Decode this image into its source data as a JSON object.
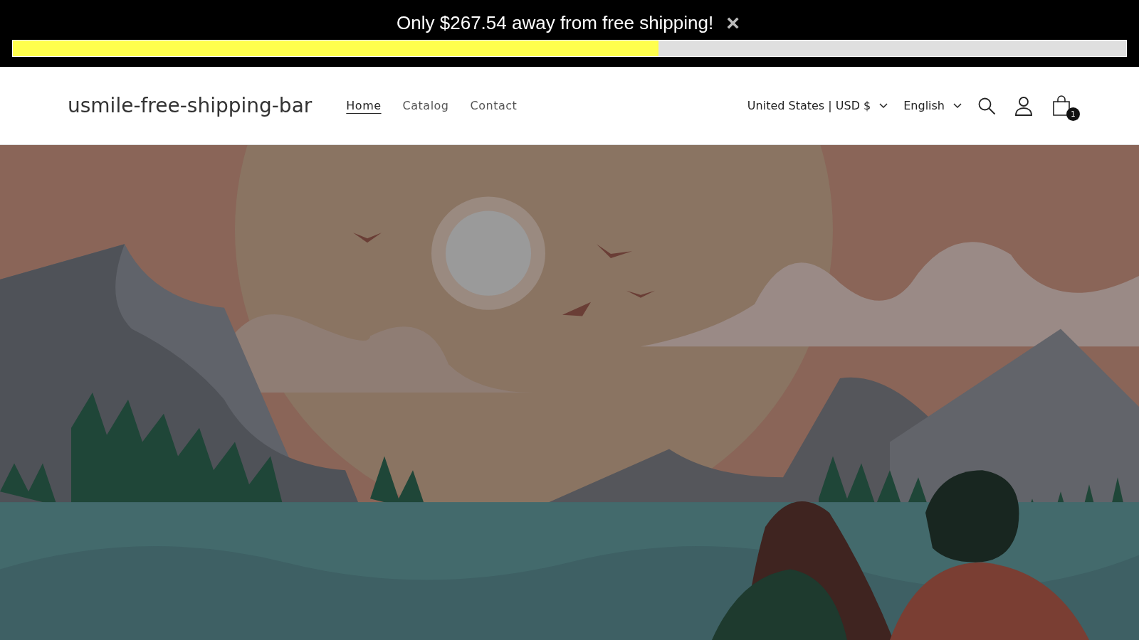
{
  "announcement": {
    "message": "Only $267.54 away from free shipping!",
    "close": "×",
    "progress": {
      "level": 0.58
    }
  },
  "header": {
    "logo": "usmile-free-shipping-bar",
    "nav": [
      {
        "label": "Home",
        "selected": true
      },
      {
        "label": "Catalog",
        "selected": false
      },
      {
        "label": "Contact",
        "selected": false
      }
    ],
    "country": "United States | USD $",
    "language": "English",
    "cart_count": "1"
  }
}
